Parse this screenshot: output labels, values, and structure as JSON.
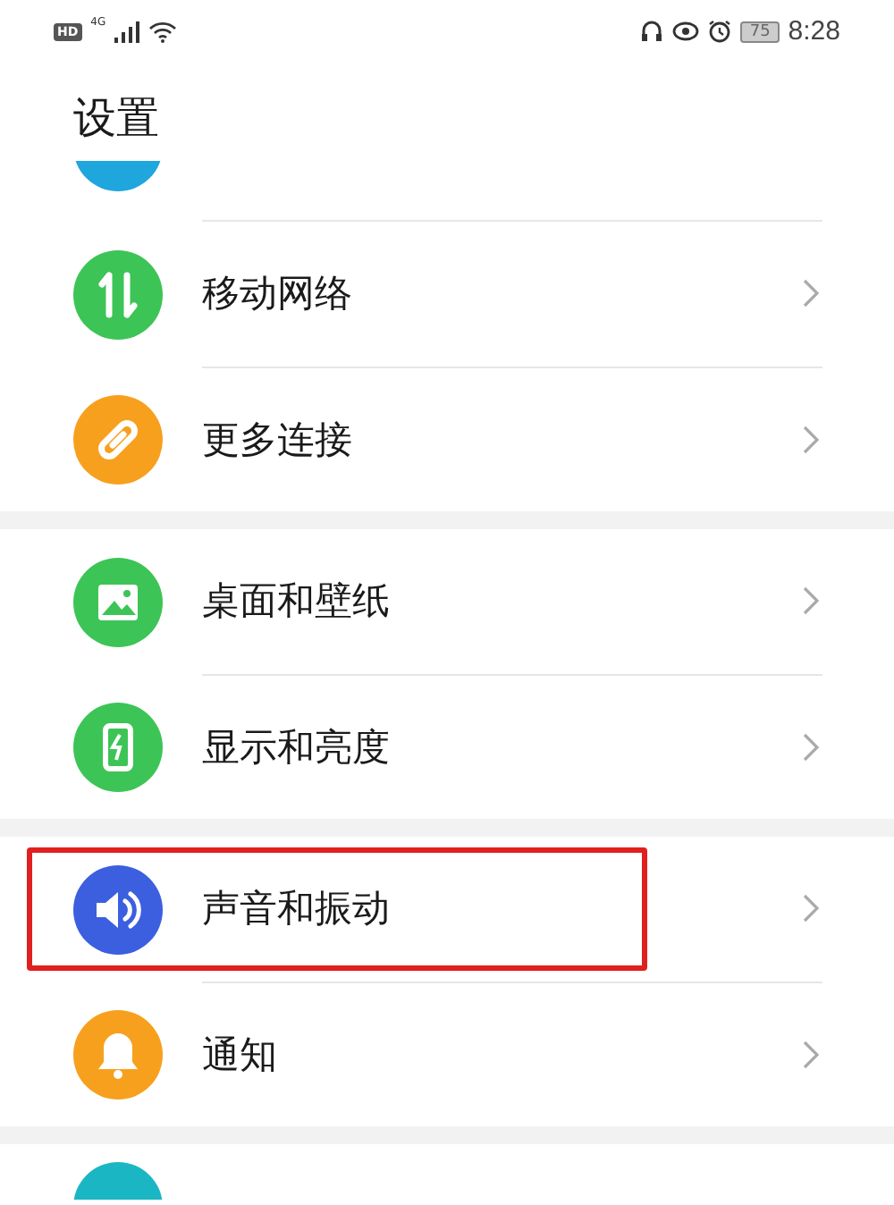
{
  "status_bar": {
    "hd": "HD",
    "network": "4G",
    "battery": "75",
    "time": "8:28"
  },
  "title": "设置",
  "groups": [
    {
      "items": [
        {
          "label": "移动网络",
          "color": "#3dc456",
          "highlighted": false
        },
        {
          "label": "更多连接",
          "color": "#f7a01e",
          "highlighted": false
        }
      ]
    },
    {
      "items": [
        {
          "label": "桌面和壁纸",
          "color": "#3dc456",
          "highlighted": false
        },
        {
          "label": "显示和亮度",
          "color": "#3dc456",
          "highlighted": false
        }
      ]
    },
    {
      "items": [
        {
          "label": "声音和振动",
          "color": "#3c5fe0",
          "highlighted": true
        },
        {
          "label": "通知",
          "color": "#f7a01e",
          "highlighted": false
        }
      ]
    }
  ]
}
